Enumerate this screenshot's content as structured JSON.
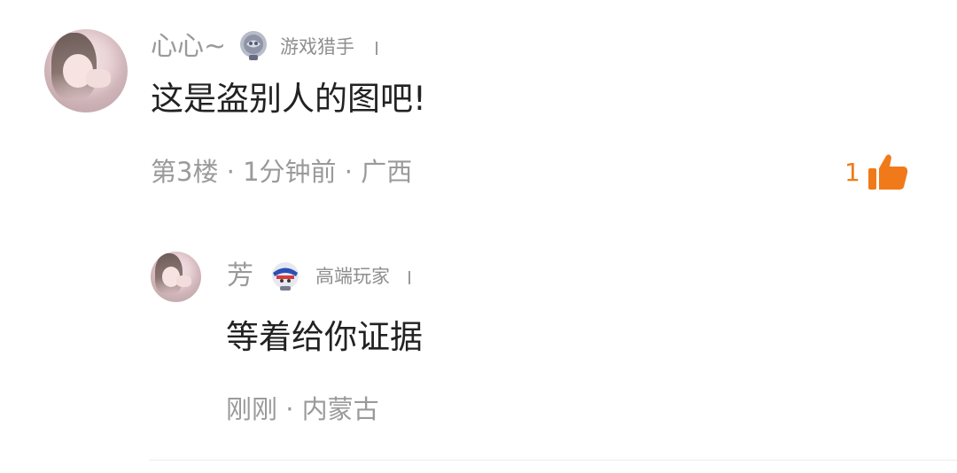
{
  "comment": {
    "username": "心心~",
    "badge": "游戏猎手",
    "text": "这是盗别人的图吧!",
    "meta": "第3楼 · 1分钟前 · 广西",
    "likes": "1",
    "avatar_icon": "user-avatar",
    "badge_icon": "game-hunter-badge-icon",
    "like_icon": "thumbs-up-icon",
    "like_color": "#f07a1a"
  },
  "reply": {
    "username": "芳",
    "badge": "高端玩家",
    "text": "等着给你证据",
    "meta": "刚刚 · 内蒙古",
    "avatar_icon": "user-avatar",
    "badge_icon": "advanced-player-badge-icon"
  }
}
